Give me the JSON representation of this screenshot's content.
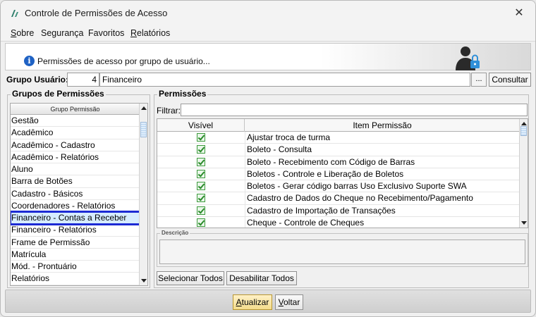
{
  "window": {
    "title": "Controle de Permissões de Acesso",
    "close_glyph": "✕"
  },
  "menu": {
    "items": [
      {
        "label": "Sobre",
        "ul": "S",
        "rest": "obre"
      },
      {
        "label": "Segurança",
        "ul": "",
        "rest": "Segurança"
      },
      {
        "label": "Favoritos",
        "ul": "",
        "rest": "Favoritos"
      },
      {
        "label": "Relatórios",
        "ul": "R",
        "rest": "elatórios"
      }
    ]
  },
  "banner": {
    "info_text": "Permissões de acesso por grupo de usuário...",
    "icon": "user-lock-icon"
  },
  "group": {
    "label": "Grupo Usuário:",
    "code": "4",
    "name": "Financeiro",
    "browse_label": "...",
    "consult_label": "Consultar"
  },
  "groups_panel": {
    "title": "Grupos de Permissões",
    "column_header": "Grupo Permissão",
    "selected": "Financeiro - Contas a Receber",
    "items": [
      "Gestão",
      "Acadêmico",
      "Acadêmico - Cadastro",
      "Acadêmico - Relatórios",
      "Aluno",
      "Barra de Botões",
      "Cadastro - Básicos",
      "Coordenadores - Relatórios",
      "Financeiro - Contas a Receber",
      "Financeiro - Relatórios",
      "Frame de Permissão",
      "Matrícula",
      "Mód. - Prontuário",
      "Relatórios"
    ]
  },
  "permissions_panel": {
    "title": "Permissões",
    "filter_label": "Filtrar:",
    "filter_value": "",
    "col_visible": "Visível",
    "col_item": "Item Permissão",
    "rows": [
      {
        "visible": true,
        "item": "Ajustar troca de turma"
      },
      {
        "visible": true,
        "item": "Boleto - Consulta"
      },
      {
        "visible": true,
        "item": "Boleto - Recebimento com Código de Barras"
      },
      {
        "visible": true,
        "item": "Boletos - Controle e Liberação de Boletos"
      },
      {
        "visible": true,
        "item": "Boletos - Gerar código barras Uso Exclusivo Suporte SWA"
      },
      {
        "visible": true,
        "item": "Cadastro de Dados do Cheque no Recebimento/Pagamento"
      },
      {
        "visible": true,
        "item": "Cadastro de Importação de Transações"
      },
      {
        "visible": true,
        "item": "Cheque - Controle de Cheques"
      }
    ],
    "description_label": "Descrição",
    "select_all_label": "Selecionar Todos",
    "disable_all_label": "Desabilitar Todos"
  },
  "footer": {
    "update_label": "Atualizar",
    "update_ul": "A",
    "update_rest": "tualizar",
    "back_label": "Voltar",
    "back_ul": "V",
    "back_rest": "oltar"
  },
  "colors": {
    "selection_outline": "#1c2ad4",
    "check_green": "#2a8a2a",
    "info_blue": "#1f62c4",
    "primary_button": "#f4dc8c"
  }
}
